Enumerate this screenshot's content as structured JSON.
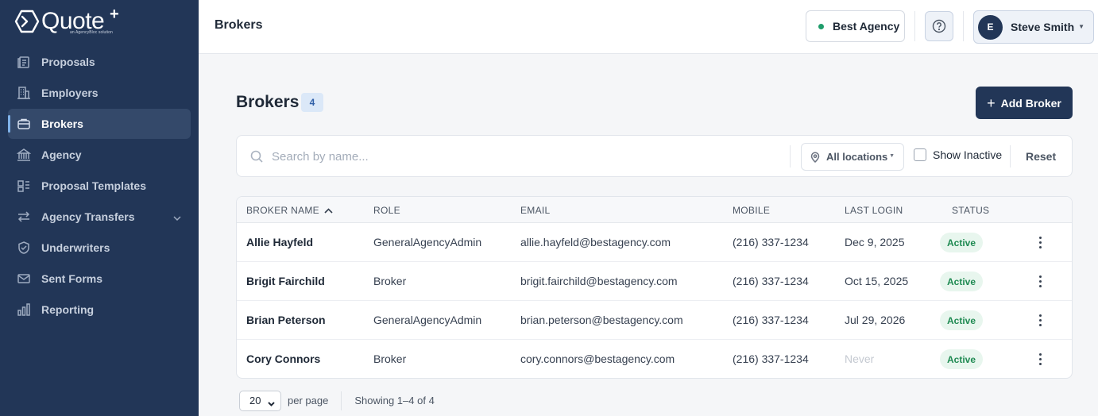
{
  "app": {
    "logo_word": "Quote",
    "logo_plus": "+",
    "logo_tagline": "an AgencyBloc solution"
  },
  "sidebar": {
    "items": [
      {
        "label": "Proposals",
        "icon": "clipboard-icon"
      },
      {
        "label": "Employers",
        "icon": "building-icon"
      },
      {
        "label": "Brokers",
        "icon": "briefcase-icon",
        "active": true
      },
      {
        "label": "Agency",
        "icon": "bank-icon"
      },
      {
        "label": "Proposal Templates",
        "icon": "template-icon"
      },
      {
        "label": "Agency Transfers",
        "icon": "transfer-icon",
        "has_submenu": true
      },
      {
        "label": "Underwriters",
        "icon": "shield-icon"
      },
      {
        "label": "Sent Forms",
        "icon": "mail-icon"
      },
      {
        "label": "Reporting",
        "icon": "bar-chart-icon"
      }
    ]
  },
  "header": {
    "title": "Brokers",
    "agency_name": "Best Agency",
    "user": {
      "initial": "E",
      "name": "Steve Smith"
    }
  },
  "main": {
    "title": "Brokers",
    "count": "4",
    "add_button": "Add Broker",
    "filters": {
      "search_placeholder": "Search by name...",
      "location": "All locations",
      "show_inactive_label": "Show Inactive",
      "show_inactive": false,
      "reset_label": "Reset"
    },
    "table": {
      "columns": [
        "BROKER NAME",
        "ROLE",
        "EMAIL",
        "MOBILE",
        "LAST LOGIN",
        "STATUS"
      ],
      "sort": {
        "column": "BROKER NAME",
        "direction": "asc"
      },
      "rows": [
        {
          "name": "Allie Hayfeld",
          "role": "GeneralAgencyAdmin",
          "email": "allie.hayfeld@bestagency.com",
          "mobile": "(216) 337-1234",
          "last_login": "Dec 9, 2025",
          "status": "Active"
        },
        {
          "name": "Brigit Fairchild",
          "role": "Broker",
          "email": "brigit.fairchild@bestagency.com",
          "mobile": "(216) 337-1234",
          "last_login": "Oct 15, 2025",
          "status": "Active"
        },
        {
          "name": "Brian Peterson",
          "role": "GeneralAgencyAdmin",
          "email": "brian.peterson@bestagency.com",
          "mobile": "(216) 337-1234",
          "last_login": "Jul 29, 2026",
          "status": "Active"
        },
        {
          "name": "Cory Connors",
          "role": "Broker",
          "email": "cory.connors@bestagency.com",
          "mobile": "(216) 337-1234",
          "last_login": "Never",
          "status": "Active"
        }
      ]
    },
    "pagination": {
      "per_page": "20",
      "per_page_label": "per page",
      "showing": "Showing 1–4 of 4"
    }
  },
  "colors": {
    "sidebar_bg": "#223657",
    "primary": "#223657",
    "status_active": "#1f8a52",
    "agency_dot": "#1f9d6b"
  }
}
